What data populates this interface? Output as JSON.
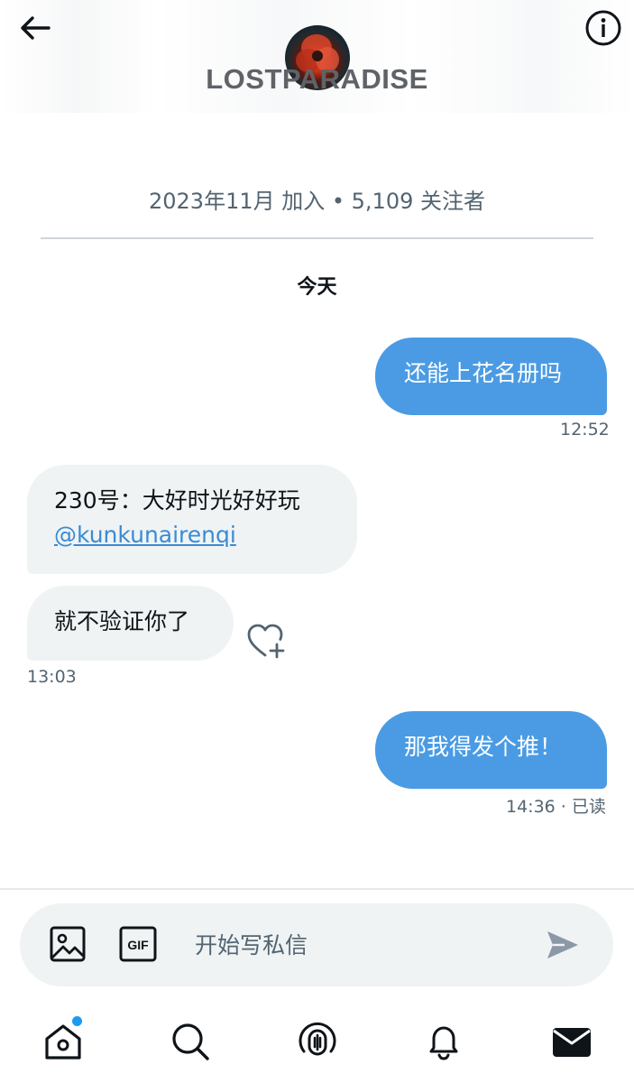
{
  "header": {
    "back_icon": "arrow-left-icon",
    "info_icon": "info-icon",
    "channel_name": "LOSTPARADISE"
  },
  "profile_meta": {
    "joined": "2023年11月 加入",
    "separator": "•",
    "followers": "5,109 关注者",
    "line": "2023年11月 加入 • 5,109 关注者"
  },
  "conversation": {
    "date_label": "今天",
    "messages": [
      {
        "direction": "out",
        "text": "还能上花名册吗",
        "time": "12:52"
      },
      {
        "direction": "in",
        "text": "230号：大好时光好好玩",
        "mention": "@kunkunairenqi"
      },
      {
        "direction": "in",
        "text": "就不验证你了",
        "time": "13:03"
      },
      {
        "direction": "out",
        "text": "那我得发个推！",
        "time": "14:36 · 已读"
      }
    ]
  },
  "composer": {
    "placeholder": "开始写私信",
    "gif_label": "GIF",
    "media_icon": "image-icon",
    "send_icon": "send-icon"
  },
  "bottom_nav": [
    {
      "name": "home",
      "icon": "home-icon",
      "has_notification_dot": true
    },
    {
      "name": "search",
      "icon": "search-icon"
    },
    {
      "name": "spaces",
      "icon": "spaces-icon"
    },
    {
      "name": "notifications",
      "icon": "bell-icon"
    },
    {
      "name": "messages",
      "icon": "mail-icon",
      "active": true
    }
  ],
  "colors": {
    "accent": "#1d9bf0",
    "outgoing_bubble": "#4a9be4",
    "incoming_bubble": "#eff3f4",
    "secondary_text": "#536471"
  }
}
